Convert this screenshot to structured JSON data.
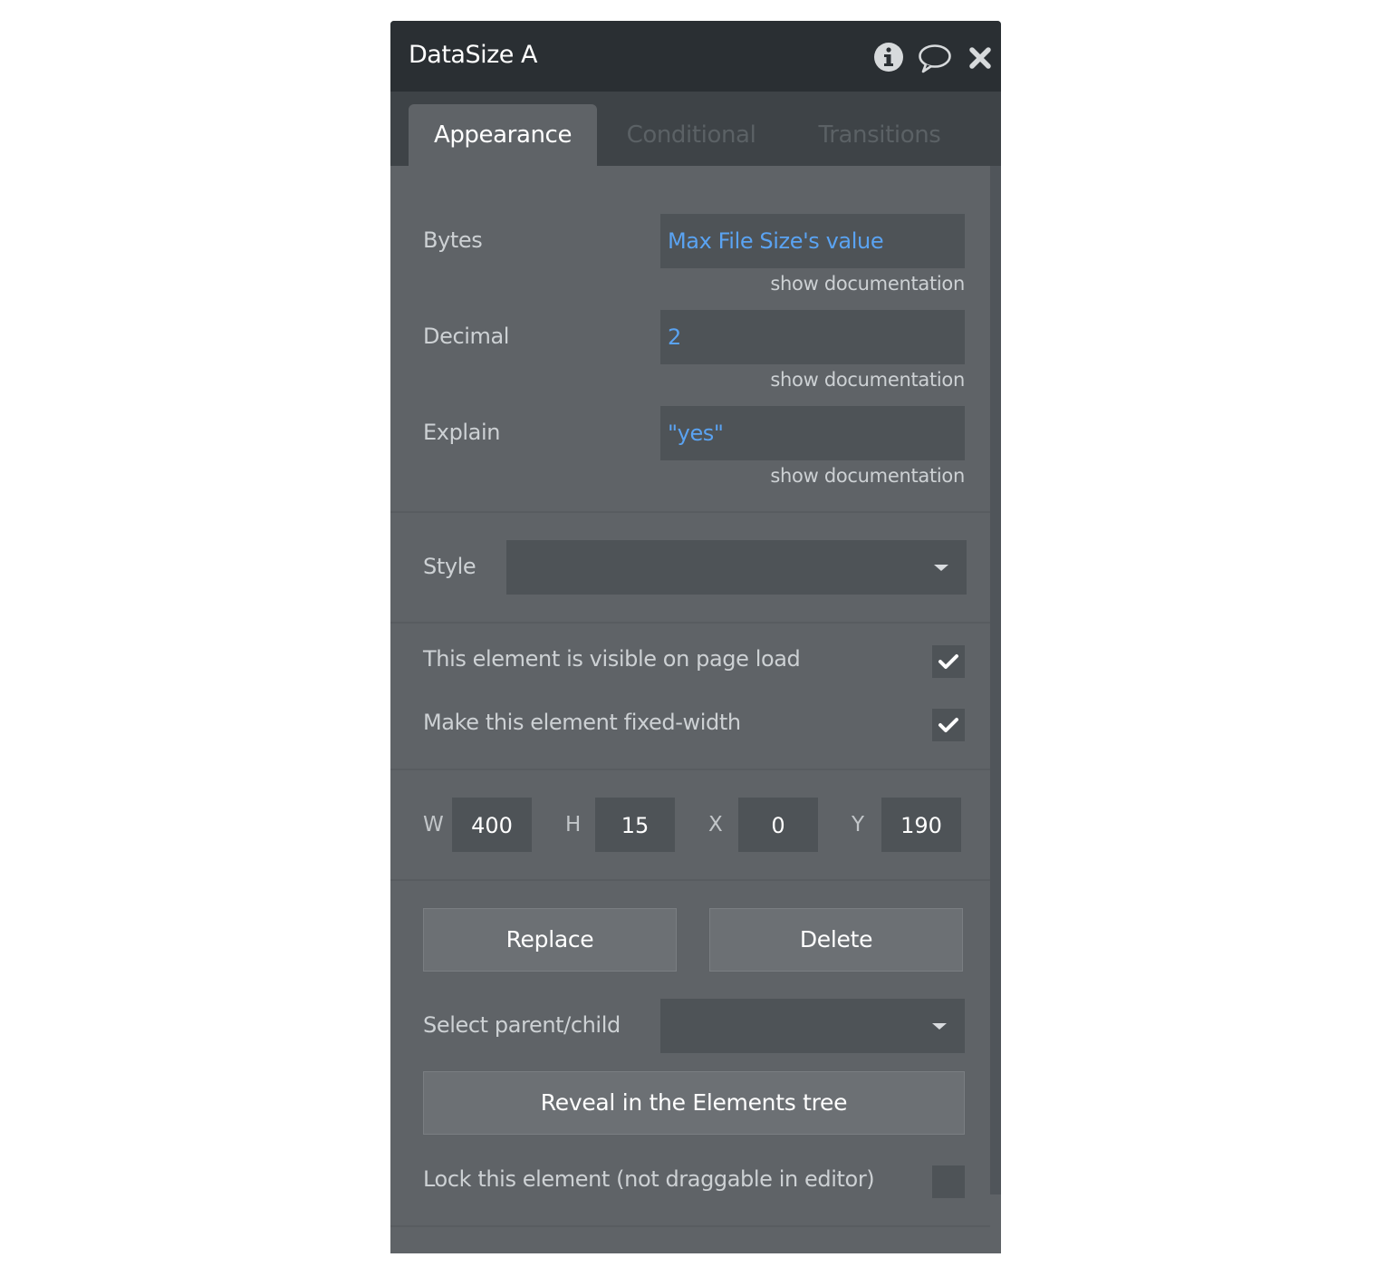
{
  "panel": {
    "title": "DataSize A",
    "header_icons": [
      "info-icon",
      "comment-icon",
      "close-icon"
    ]
  },
  "tabs": [
    {
      "label": "Appearance",
      "active": true
    },
    {
      "label": "Conditional",
      "active": false
    },
    {
      "label": "Transitions",
      "active": false
    }
  ],
  "fields": {
    "bytes": {
      "label": "Bytes",
      "value": "Max File Size's value",
      "doc": "show documentation"
    },
    "decimal": {
      "label": "Decimal",
      "value": "2",
      "doc": "show documentation"
    },
    "explain": {
      "label": "Explain",
      "value": "\"yes\"",
      "doc": "show documentation"
    }
  },
  "style": {
    "label": "Style",
    "value": ""
  },
  "options": {
    "visible_on_load": {
      "label": "This element is visible on page load",
      "checked": true
    },
    "fixed_width": {
      "label": "Make this element fixed-width",
      "checked": true
    }
  },
  "dimensions": {
    "w": {
      "label": "W",
      "value": "400"
    },
    "h": {
      "label": "H",
      "value": "15"
    },
    "x": {
      "label": "X",
      "value": "0"
    },
    "y": {
      "label": "Y",
      "value": "190"
    }
  },
  "actions": {
    "replace_label": "Replace",
    "delete_label": "Delete",
    "select_parent_child_label": "Select parent/child",
    "reveal_label": "Reveal in the Elements tree"
  },
  "lock": {
    "label": "Lock this element (not draggable in editor)",
    "checked": false
  },
  "colors": {
    "title_bar": "#2a2f33",
    "panel_bg": "#5f6367",
    "field_bg": "#4e5357",
    "dynamic_value": "#5aa3f2"
  }
}
